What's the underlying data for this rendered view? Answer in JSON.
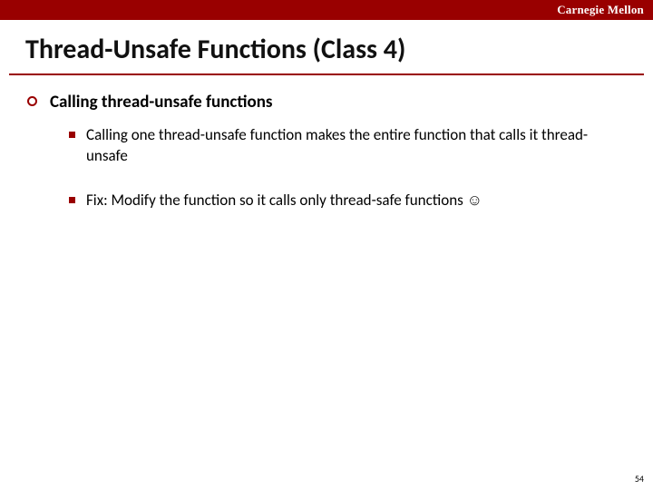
{
  "brand": "Carnegie Mellon",
  "title": "Thread-Unsafe Functions (Class 4)",
  "bullet1": "Calling thread-unsafe functions",
  "sub1": "Calling one thread-unsafe function makes the entire function that calls it thread-unsafe",
  "sub2": "Fix: Modify the function so it calls only thread-safe functions ☺",
  "page_number": "54"
}
